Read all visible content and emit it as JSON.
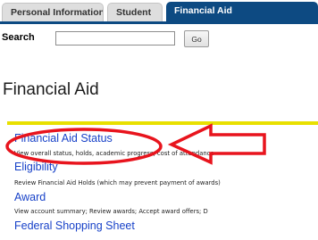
{
  "tabs": [
    {
      "label": "Personal Information",
      "active": false
    },
    {
      "label": "Student",
      "active": false
    },
    {
      "label": "Financial Aid",
      "active": true
    }
  ],
  "search": {
    "label": "Search",
    "value": "",
    "button_label": "Go"
  },
  "page_title": "Financial Aid",
  "menu": [
    {
      "label": "Financial Aid Status",
      "description": "View overall status, holds, academic progress, cost of attendance"
    },
    {
      "label": "Eligibility",
      "description": "Review Financial Aid Holds (which may prevent payment of awards)"
    },
    {
      "label": "Award",
      "description": "View account summary; Review awards; Accept award offers; D"
    },
    {
      "label": "Federal Shopping Sheet",
      "description": ""
    }
  ],
  "colors": {
    "tab_active": "#0d4a82",
    "link": "#1842c8",
    "divider": "#e8e000",
    "annotation": "#e8141d"
  },
  "annotation": {
    "shape": "ellipse-and-left-arrow",
    "highlights": "Financial Aid Status"
  }
}
